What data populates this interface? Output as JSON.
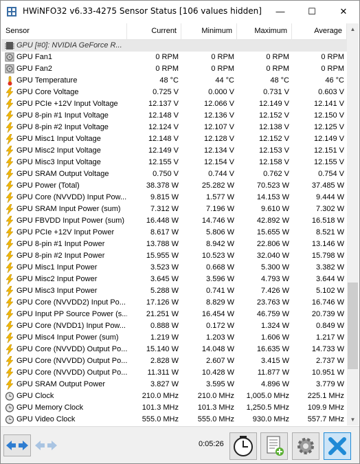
{
  "window": {
    "title": "HWiNFO32 v6.33-4275 Sensor Status [106 values hidden]",
    "minimize_glyph": "—",
    "maximize_glyph": "☐",
    "close_glyph": "✕"
  },
  "columns": {
    "sensor": "Sensor",
    "current": "Current",
    "minimum": "Minimum",
    "maximum": "Maximum",
    "average": "Average"
  },
  "rows": [
    {
      "name": "GPU [#0]: NVIDIA GeForce R...",
      "current": "",
      "minimum": "",
      "maximum": "",
      "average": "",
      "icon": "chip-icon",
      "group": true
    },
    {
      "name": "GPU Fan1",
      "current": "0 RPM",
      "minimum": "0 RPM",
      "maximum": "0 RPM",
      "average": "0 RPM",
      "icon": "fan-icon"
    },
    {
      "name": "GPU Fan2",
      "current": "0 RPM",
      "minimum": "0 RPM",
      "maximum": "0 RPM",
      "average": "0 RPM",
      "icon": "fan-icon"
    },
    {
      "name": "GPU Temperature",
      "current": "48 °C",
      "minimum": "44 °C",
      "maximum": "48 °C",
      "average": "46 °C",
      "icon": "thermometer-icon"
    },
    {
      "name": "GPU Core Voltage",
      "current": "0.725 V",
      "minimum": "0.000 V",
      "maximum": "0.731 V",
      "average": "0.603 V",
      "icon": "lightning-icon"
    },
    {
      "name": "GPU PCIe +12V Input Voltage",
      "current": "12.137 V",
      "minimum": "12.066 V",
      "maximum": "12.149 V",
      "average": "12.141 V",
      "icon": "lightning-icon"
    },
    {
      "name": "GPU 8-pin #1 Input Voltage",
      "current": "12.148 V",
      "minimum": "12.136 V",
      "maximum": "12.152 V",
      "average": "12.150 V",
      "icon": "lightning-icon"
    },
    {
      "name": "GPU 8-pin #2 Input Voltage",
      "current": "12.124 V",
      "minimum": "12.107 V",
      "maximum": "12.138 V",
      "average": "12.125 V",
      "icon": "lightning-icon"
    },
    {
      "name": "GPU Misc1 Input Voltage",
      "current": "12.148 V",
      "minimum": "12.128 V",
      "maximum": "12.152 V",
      "average": "12.149 V",
      "icon": "lightning-icon"
    },
    {
      "name": "GPU Misc2 Input Voltage",
      "current": "12.149 V",
      "minimum": "12.134 V",
      "maximum": "12.153 V",
      "average": "12.151 V",
      "icon": "lightning-icon"
    },
    {
      "name": "GPU Misc3 Input Voltage",
      "current": "12.155 V",
      "minimum": "12.154 V",
      "maximum": "12.158 V",
      "average": "12.155 V",
      "icon": "lightning-icon"
    },
    {
      "name": "GPU SRAM Output Voltage",
      "current": "0.750 V",
      "minimum": "0.744 V",
      "maximum": "0.762 V",
      "average": "0.754 V",
      "icon": "lightning-icon"
    },
    {
      "name": "GPU Power (Total)",
      "current": "38.378 W",
      "minimum": "25.282 W",
      "maximum": "70.523 W",
      "average": "37.485 W",
      "icon": "lightning-icon"
    },
    {
      "name": "GPU Core (NVVDD) Input Pow...",
      "current": "9.815 W",
      "minimum": "1.577 W",
      "maximum": "14.153 W",
      "average": "9.444 W",
      "icon": "lightning-icon"
    },
    {
      "name": "GPU SRAM Input Power (sum)",
      "current": "7.312 W",
      "minimum": "7.196 W",
      "maximum": "9.610 W",
      "average": "7.302 W",
      "icon": "lightning-icon"
    },
    {
      "name": "GPU FBVDD Input Power (sum)",
      "current": "16.448 W",
      "minimum": "14.746 W",
      "maximum": "42.892 W",
      "average": "16.518 W",
      "icon": "lightning-icon"
    },
    {
      "name": "GPU PCIe +12V Input Power",
      "current": "8.617 W",
      "minimum": "5.806 W",
      "maximum": "15.655 W",
      "average": "8.521 W",
      "icon": "lightning-icon"
    },
    {
      "name": "GPU 8-pin #1 Input Power",
      "current": "13.788 W",
      "minimum": "8.942 W",
      "maximum": "22.806 W",
      "average": "13.146 W",
      "icon": "lightning-icon"
    },
    {
      "name": "GPU 8-pin #2 Input Power",
      "current": "15.955 W",
      "minimum": "10.523 W",
      "maximum": "32.040 W",
      "average": "15.798 W",
      "icon": "lightning-icon"
    },
    {
      "name": "GPU Misc1 Input Power",
      "current": "3.523 W",
      "minimum": "0.668 W",
      "maximum": "5.300 W",
      "average": "3.382 W",
      "icon": "lightning-icon"
    },
    {
      "name": "GPU Misc2 Input Power",
      "current": "3.645 W",
      "minimum": "3.596 W",
      "maximum": "4.793 W",
      "average": "3.644 W",
      "icon": "lightning-icon"
    },
    {
      "name": "GPU Misc3 Input Power",
      "current": "5.288 W",
      "minimum": "0.741 W",
      "maximum": "7.426 W",
      "average": "5.102 W",
      "icon": "lightning-icon"
    },
    {
      "name": "GPU Core (NVVDD2) Input Po...",
      "current": "17.126 W",
      "minimum": "8.829 W",
      "maximum": "23.763 W",
      "average": "16.746 W",
      "icon": "lightning-icon"
    },
    {
      "name": "GPU Input PP Source Power (s...",
      "current": "21.251 W",
      "minimum": "16.454 W",
      "maximum": "46.759 W",
      "average": "20.739 W",
      "icon": "lightning-icon"
    },
    {
      "name": "GPU Core (NVDD1) Input Pow...",
      "current": "0.888 W",
      "minimum": "0.172 W",
      "maximum": "1.324 W",
      "average": "0.849 W",
      "icon": "lightning-icon"
    },
    {
      "name": "GPU Misc4 Input Power (sum)",
      "current": "1.219 W",
      "minimum": "1.203 W",
      "maximum": "1.606 W",
      "average": "1.217 W",
      "icon": "lightning-icon"
    },
    {
      "name": "GPU Core (NVVDD) Output Po...",
      "current": "15.140 W",
      "minimum": "14.048 W",
      "maximum": "16.635 W",
      "average": "14.733 W",
      "icon": "lightning-icon"
    },
    {
      "name": "GPU Core (NVVDD) Output Po...",
      "current": "2.828 W",
      "minimum": "2.607 W",
      "maximum": "3.415 W",
      "average": "2.737 W",
      "icon": "lightning-icon"
    },
    {
      "name": "GPU Core (NVVDD) Output Po...",
      "current": "11.311 W",
      "minimum": "10.428 W",
      "maximum": "11.877 W",
      "average": "10.951 W",
      "icon": "lightning-icon"
    },
    {
      "name": "GPU SRAM Output Power",
      "current": "3.827 W",
      "minimum": "3.595 W",
      "maximum": "4.896 W",
      "average": "3.779 W",
      "icon": "lightning-icon"
    },
    {
      "name": "GPU Clock",
      "current": "210.0 MHz",
      "minimum": "210.0 MHz",
      "maximum": "1,005.0 MHz",
      "average": "225.1 MHz",
      "icon": "clock-icon"
    },
    {
      "name": "GPU Memory Clock",
      "current": "101.3 MHz",
      "minimum": "101.3 MHz",
      "maximum": "1,250.5 MHz",
      "average": "109.9 MHz",
      "icon": "clock-icon"
    },
    {
      "name": "GPU Video Clock",
      "current": "555.0 MHz",
      "minimum": "555.0 MHz",
      "maximum": "930.0 MHz",
      "average": "557.7 MHz",
      "icon": "clock-icon"
    }
  ],
  "footer": {
    "elapsed_time": "0:05:26"
  },
  "colors": {
    "lightning": "#f2b705",
    "thermometer": "#f0c020",
    "fan": "#707070",
    "nav_arrow": "#2e7dd1",
    "close_button": "#1f8ad6"
  }
}
